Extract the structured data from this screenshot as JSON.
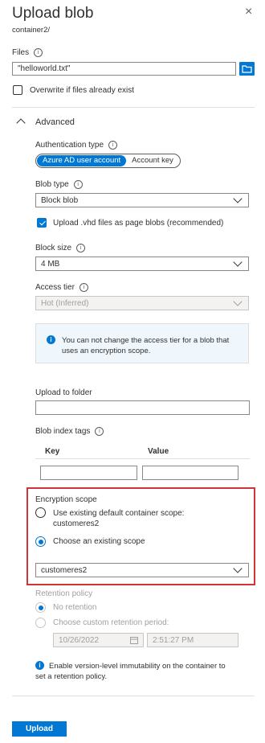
{
  "header": {
    "title": "Upload blob",
    "subtitle": "container2/",
    "close_icon": "×"
  },
  "files": {
    "label": "Files",
    "value": "\"helloworld.txt\""
  },
  "overwrite": {
    "label": "Overwrite if files already exist",
    "checked": false
  },
  "advanced": {
    "label": "Advanced",
    "expanded": true
  },
  "auth": {
    "label": "Authentication type",
    "options": [
      "Azure AD user account",
      "Account key"
    ],
    "selected": "Azure AD user account"
  },
  "blob_type": {
    "label": "Blob type",
    "value": "Block blob"
  },
  "vhd": {
    "label": "Upload .vhd files as page blobs (recommended)",
    "checked": true
  },
  "block_size": {
    "label": "Block size",
    "value": "4 MB"
  },
  "access_tier": {
    "label": "Access tier",
    "value": "Hot (Inferred)",
    "disabled": true
  },
  "tier_info": {
    "line1": "You can not change the access tier for a blob that",
    "line2": "uses an encryption scope."
  },
  "upload_folder": {
    "label": "Upload to folder",
    "value": ""
  },
  "tags": {
    "label": "Blob index tags",
    "key_header": "Key",
    "value_header": "Value"
  },
  "encryption": {
    "label": "Encryption scope",
    "option1_line1": "Use existing default container scope:",
    "option1_line2": "customeres2",
    "option2": "Choose an existing scope",
    "selected": "Choose an existing scope",
    "scope_value": "customeres2",
    "highlight_color": "#d13438"
  },
  "retention": {
    "label": "Retention policy",
    "option1": "No retention",
    "option2": "Choose custom retention period:",
    "date": "10/26/2022",
    "time": "2:51:27 PM"
  },
  "immutability": {
    "line1": "Enable version-level immutability on the container to",
    "line2": "set a retention policy."
  },
  "footer": {
    "upload_label": "Upload"
  },
  "colors": {
    "accent": "#0078d4",
    "highlight": "#d13438"
  }
}
